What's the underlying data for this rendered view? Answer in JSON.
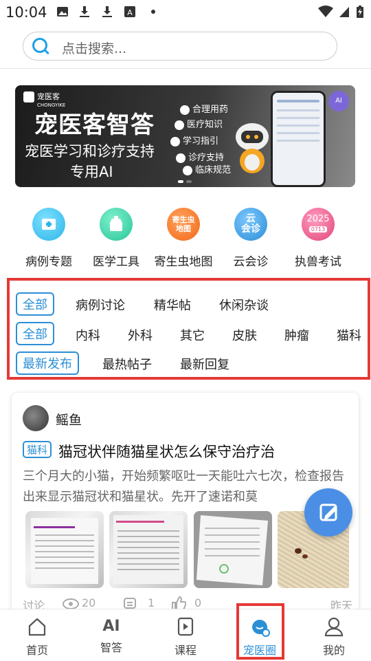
{
  "status_bar": {
    "time": "10:04"
  },
  "search": {
    "placeholder": "点击搜索..."
  },
  "banner": {
    "logo_text": "宠医客",
    "logo_sub": "CHONGYIKE",
    "title": "宠医客智答",
    "subtitle_1": "宠医学习和诊疗支持",
    "subtitle_2": "专用AI",
    "features": [
      "合理用药",
      "医疗知识",
      "学习指引",
      "诊疗支持",
      "临床规范"
    ],
    "ai_badge": "AI"
  },
  "shortcuts": [
    {
      "label": "病例专题",
      "icon": "case-folder-icon",
      "color": "#2bb6e8"
    },
    {
      "label": "医学工具",
      "icon": "medical-tool-icon",
      "color": "#28c59a"
    },
    {
      "label": "寄生虫地图",
      "icon": "parasite-map-icon",
      "color": "#f26a1b",
      "icon_text": "寄生虫地图"
    },
    {
      "label": "云会诊",
      "icon": "cloud-consult-icon",
      "color": "#2b8fd6",
      "icon_text": "云会诊"
    },
    {
      "label": "执兽考试",
      "icon": "exam-2025-icon",
      "color": "#e2457a",
      "icon_text": "2025",
      "icon_sub": "0713"
    }
  ],
  "filters": {
    "category": [
      "全部",
      "病例讨论",
      "精华帖",
      "休闲杂谈"
    ],
    "department": [
      "全部",
      "内科",
      "外科",
      "其它",
      "皮肤",
      "肿瘤",
      "猫科"
    ],
    "sort": [
      "最新发布",
      "最热帖子",
      "最新回复"
    ],
    "selected": {
      "category": "全部",
      "department": "全部",
      "sort": "最新发布"
    }
  },
  "post": {
    "author": "鳐鱼",
    "tag": "猫科",
    "title": "猫冠状伴随猫星状怎么保守治疗治",
    "excerpt": "三个月大的小猫，开始频繁呕吐一天能吐六七次，检查报告出来显示猫冠状和猫星状。先开了速诺和莫",
    "type_label": "讨论",
    "views": "20",
    "comments": "1",
    "likes": "0",
    "time": "昨天"
  },
  "bottom_nav": [
    {
      "label": "首页",
      "icon": "home-icon"
    },
    {
      "label": "智答",
      "icon": "ai-icon",
      "icon_text": "AI"
    },
    {
      "label": "课程",
      "icon": "course-play-icon"
    },
    {
      "label": "宠医圈",
      "icon": "pet-circle-icon",
      "active": true
    },
    {
      "label": "我的",
      "icon": "profile-icon"
    }
  ],
  "colors": {
    "accent": "#2b8fd6",
    "highlight": "#e53935",
    "fab": "#4a8fe5"
  }
}
